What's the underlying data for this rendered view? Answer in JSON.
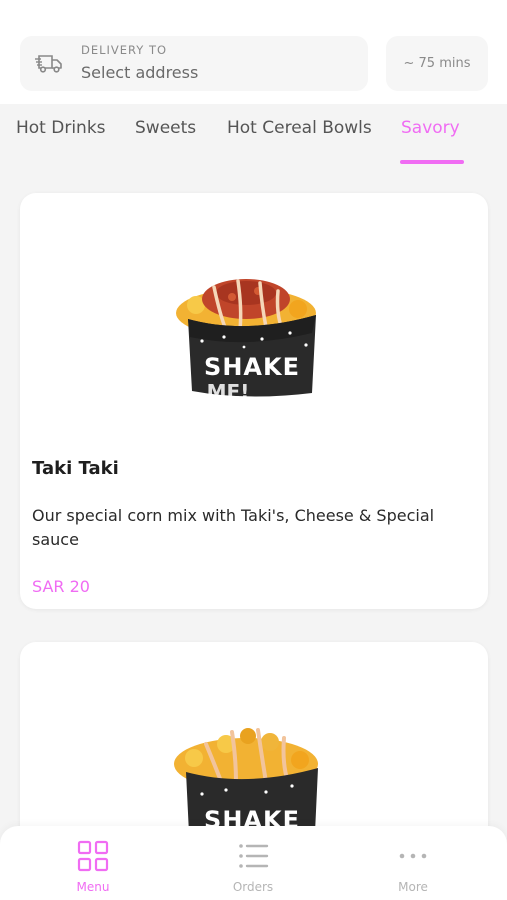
{
  "header": {
    "delivery_label": "DELIVERY TO",
    "address_placeholder": "Select address",
    "eta": "~ 75 mins"
  },
  "tabs": [
    {
      "label": "Hot Drinks",
      "active": false
    },
    {
      "label": "Sweets",
      "active": false
    },
    {
      "label": "Hot Cereal Bowls",
      "active": false
    },
    {
      "label": "Savory",
      "active": true
    }
  ],
  "products": [
    {
      "name": "Taki Taki",
      "description": "Our special corn mix with Taki's, Cheese & Special sauce",
      "price": "SAR 20",
      "image_text": "SHAKE ME!"
    },
    {
      "image_text": "SHAKE"
    }
  ],
  "bottom_nav": [
    {
      "label": "Menu",
      "icon": "grid-icon",
      "active": true
    },
    {
      "label": "Orders",
      "icon": "list-icon",
      "active": false
    },
    {
      "label": "More",
      "icon": "more-dots-icon",
      "active": false
    }
  ],
  "colors": {
    "accent": "#f06cf3",
    "background": "#f4f4f4",
    "card": "#ffffff"
  }
}
